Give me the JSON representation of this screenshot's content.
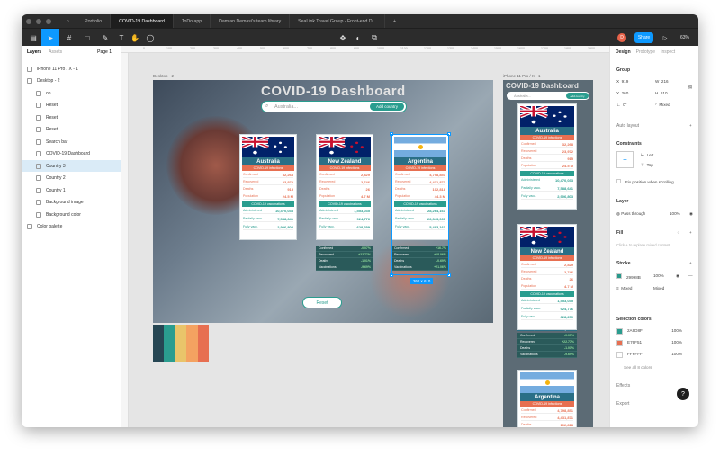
{
  "tabs": [
    {
      "label": "Portfolio"
    },
    {
      "label": "COVID-19 Dashboard",
      "active": true
    },
    {
      "label": "ToDo app"
    },
    {
      "label": "Damian Demasi's team library"
    },
    {
      "label": "SeaLink Travel Group - Front-end D..."
    }
  ],
  "toolbar": {
    "share": "Share",
    "zoom": "63%",
    "avatar": "D"
  },
  "left_panel": {
    "tabs": [
      "Layers",
      "Assets"
    ],
    "page": "Page 1",
    "layers": [
      {
        "label": "iPhone 11 Pro / X - 1",
        "icon": "frame-icon",
        "depth": 0
      },
      {
        "label": "Desktop - 2",
        "icon": "frame-icon",
        "depth": 0
      },
      {
        "label": "on",
        "icon": "text-icon",
        "depth": 1
      },
      {
        "label": "Reset",
        "icon": "component-icon",
        "depth": 1
      },
      {
        "label": "Reset",
        "icon": "component-icon",
        "depth": 1
      },
      {
        "label": "Reset",
        "icon": "component-icon",
        "depth": 1
      },
      {
        "label": "Search bar",
        "icon": "component-icon",
        "depth": 1
      },
      {
        "label": "COVID-19 Dashboard",
        "icon": "text-icon",
        "depth": 1
      },
      {
        "label": "Country 3",
        "icon": "group-icon",
        "depth": 1,
        "selected": true
      },
      {
        "label": "Country 2",
        "icon": "group-icon",
        "depth": 1
      },
      {
        "label": "Country 1",
        "icon": "group-icon",
        "depth": 1
      },
      {
        "label": "Background image",
        "icon": "image-icon",
        "depth": 1
      },
      {
        "label": "Background color",
        "icon": "rect-icon",
        "depth": 1
      },
      {
        "label": "Color palette",
        "icon": "frame-icon",
        "depth": 0
      }
    ]
  },
  "canvas": {
    "frame_desktop": "Desktop - 2",
    "frame_phone": "iPhone 11 Pro / X - 1",
    "title": "COVID-19 Dashboard",
    "search_placeholder": "Australia...",
    "add_button": "Add country",
    "reset": "Reset",
    "selection_size": "260 × 610",
    "ruler_marks": [
      "0",
      "100",
      "200",
      "300",
      "400",
      "500",
      "600",
      "700",
      "800",
      "900",
      "1000",
      "1100",
      "1200",
      "1300",
      "1400",
      "1500",
      "1600",
      "1700",
      "1800",
      "1900"
    ],
    "cards": [
      {
        "name": "Australia",
        "flag": "au",
        "inf_title": "COVID-19 infections",
        "vac_title": "COVID-19 vaccinations",
        "rows": [
          [
            "Confirmed",
            "32,268"
          ],
          [
            "Recovered",
            "23,972"
          ],
          [
            "Deaths",
            "915"
          ],
          [
            "Population",
            "24.5 M"
          ]
        ],
        "vrows": [
          [
            "Administered",
            "10,470,033"
          ],
          [
            "Partially vacc.",
            "7,588,641"
          ],
          [
            "Fully vacc.",
            "2,906,803"
          ]
        ]
      },
      {
        "name": "New Zealand",
        "flag": "nz",
        "inf_title": "COVID-19 infections",
        "vac_title": "COVID-19 vaccinations",
        "rows": [
          [
            "Confirmed",
            "2,829"
          ],
          [
            "Recovered",
            "2,746"
          ],
          [
            "Deaths",
            "26"
          ],
          [
            "Population",
            "4.7 M"
          ]
        ],
        "vrows": [
          [
            "Administered",
            "1,553,035"
          ],
          [
            "Partially vacc.",
            "924,776"
          ],
          [
            "Fully vacc.",
            "628,259"
          ]
        ],
        "comp": [
          [
            "Confirmed",
            "-0.07%"
          ],
          [
            "Recovered",
            "+22.77%"
          ],
          [
            "Deaths",
            "-1.01%"
          ],
          [
            "Vaccinations",
            "-9.69%"
          ]
        ]
      },
      {
        "name": "Argentina",
        "flag": "ar",
        "inf_title": "COVID-19 infections",
        "vac_title": "COVID-19 vaccinations",
        "rows": [
          [
            "Confirmed",
            "4,798,851"
          ],
          [
            "Recovered",
            "4,431,871"
          ],
          [
            "Deaths",
            "102,818"
          ],
          [
            "Population",
            "44.3 M"
          ]
        ],
        "vrows": [
          [
            "Administered",
            "28,264,161"
          ],
          [
            "Partially vacc.",
            "22,343,067"
          ],
          [
            "Fully vacc.",
            "5,483,161"
          ]
        ],
        "comp": [
          [
            "Confirmed",
            "+16.7%"
          ],
          [
            "Recovered",
            "+18.06%"
          ],
          [
            "Deaths",
            "-0.69%"
          ],
          [
            "Vaccinations",
            "+21.06%"
          ]
        ]
      }
    ],
    "phone_comparison_title": "Comparison with first country"
  },
  "right_panel": {
    "tabs": [
      "Design",
      "Prototype",
      "Inspect"
    ],
    "group": "Group",
    "x": "919",
    "y": "260",
    "w": "216",
    "h": "610",
    "rotation": "0°",
    "corner": "Mixed",
    "auto_layout": "Auto layout",
    "constraints": "Constraints",
    "c_h": "Left",
    "c_v": "Top",
    "fix_scroll": "Fix position when scrolling",
    "layer": "Layer",
    "blend": "Pass through",
    "opacity": "100%",
    "fill": "Fill",
    "fill_hint": "Click + to replace mixed content",
    "stroke": "Stroke",
    "stroke_color": "29998B",
    "stroke_opacity": "100%",
    "stroke_mixed1": "Mixed",
    "stroke_mixed2": "Mixed",
    "selection_colors": "Selection colors",
    "colors": [
      {
        "hex": "2A9D8F",
        "pct": "100%",
        "color": "#2a9d8f"
      },
      {
        "hex": "E76F51",
        "pct": "100%",
        "color": "#e76f51"
      },
      {
        "hex": "FFFFFF",
        "pct": "100%",
        "color": "#ffffff"
      }
    ],
    "see_all": "See all 8 colors",
    "effects": "Effects",
    "export": "Export"
  },
  "palette": [
    "#264653",
    "#2a9d8f",
    "#e9c46a",
    "#f4a261",
    "#e76f51"
  ]
}
